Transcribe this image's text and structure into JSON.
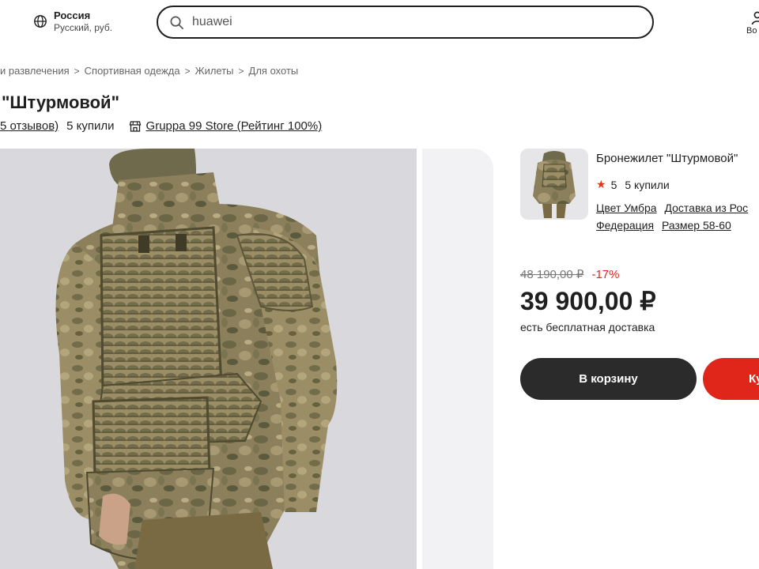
{
  "header": {
    "region_country": "Россия",
    "region_locale": "Русский, руб.",
    "search_value": "huawei",
    "right_label": "Во"
  },
  "breadcrumb": [
    "и развлечения",
    "Спортивная одежда",
    "Жилеты",
    "Для охоты"
  ],
  "product": {
    "title": "\"Штурмовой\"",
    "reviews_link": "5 отзывов)",
    "bought": "5 купили",
    "store": "Gruppa 99 Store (Рейтинг 100%)"
  },
  "card": {
    "name": "Бронежилет \"Штурмовой\"",
    "rating": "5",
    "bought": "5 купили",
    "attributes": [
      "Цвет Умбра",
      "Доставка из Рос",
      "Федерация",
      "Размер 58-60"
    ]
  },
  "price": {
    "old": "48 190,00 ₽",
    "discount": "-17%",
    "current": "39 900,00 ₽",
    "delivery": "есть бесплатная доставка"
  },
  "buttons": {
    "cart": "В корзину",
    "buy": "Ку"
  },
  "colors": {
    "accent_red": "#e0261b",
    "dark_button": "#2b2b2b",
    "star": "#d63a1f"
  }
}
